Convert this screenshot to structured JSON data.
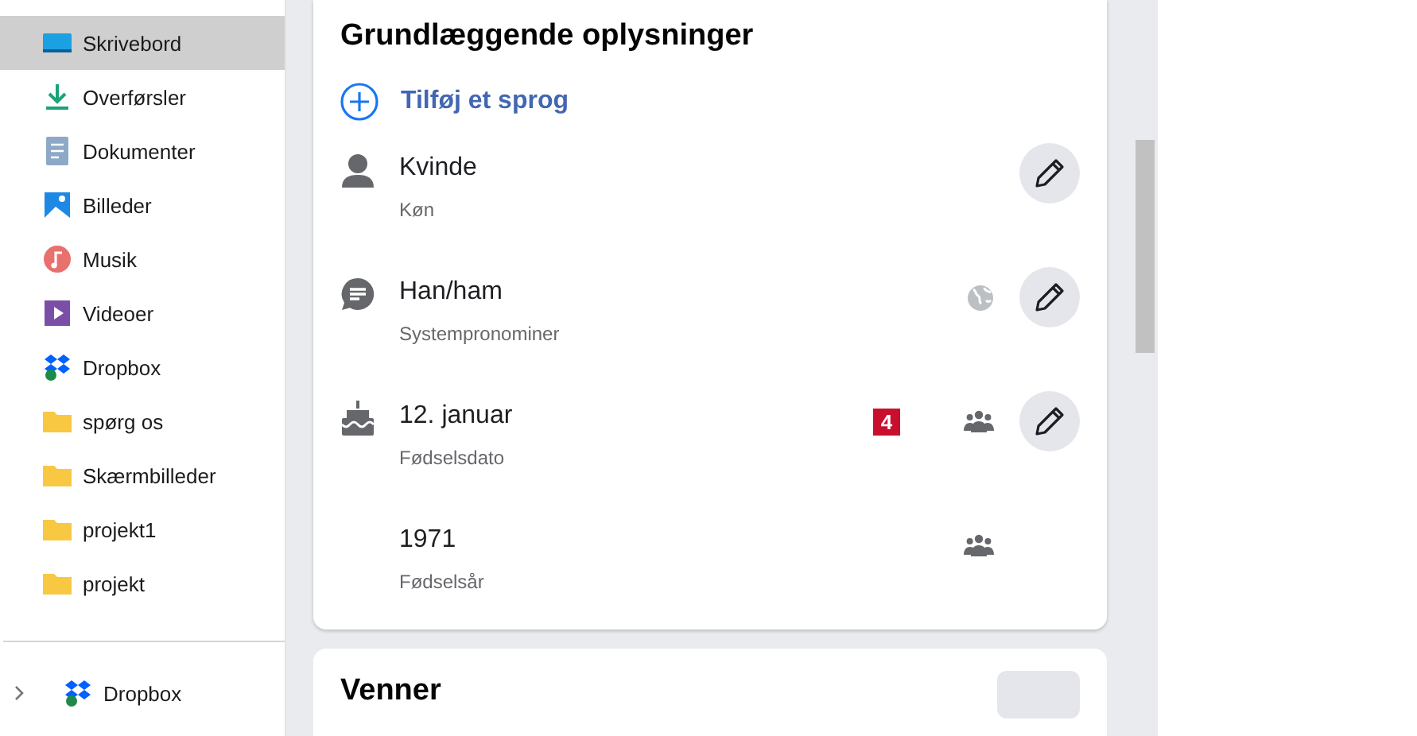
{
  "sidebar": {
    "items": [
      {
        "label": "Skrivebord",
        "kind": "desktop",
        "selected": true
      },
      {
        "label": "Overførsler",
        "kind": "download",
        "selected": false
      },
      {
        "label": "Dokumenter",
        "kind": "document",
        "selected": false
      },
      {
        "label": "Billeder",
        "kind": "pictures",
        "selected": false
      },
      {
        "label": "Musik",
        "kind": "music",
        "selected": false
      },
      {
        "label": "Videoer",
        "kind": "video",
        "selected": false
      },
      {
        "label": "Dropbox",
        "kind": "dropbox",
        "selected": false
      },
      {
        "label": "spørg os",
        "kind": "folder",
        "selected": false
      },
      {
        "label": "Skærmbilleder",
        "kind": "folder",
        "selected": false
      },
      {
        "label": "projekt1",
        "kind": "folder",
        "selected": false
      },
      {
        "label": "projekt",
        "kind": "folder",
        "selected": false
      }
    ],
    "footer": {
      "label": "Dropbox",
      "expanded": false
    }
  },
  "basic_info": {
    "title": "Grundlæggende oplysninger",
    "add_link": "Tilføj et sprog",
    "fields": [
      {
        "value": "Kvinde",
        "label": "Køn",
        "kind": "person",
        "editable": true
      },
      {
        "value": "Han/ham",
        "label": "Systempronominer",
        "kind": "chat",
        "audience": {
          "kind": "public"
        },
        "editable": true
      },
      {
        "value": "12. januar",
        "label": "Fødselsdato",
        "kind": "cake",
        "audience": {
          "kind": "friends"
        },
        "editable": true,
        "badge": "4"
      },
      {
        "value": "1971",
        "label": "Fødselsår",
        "kind": "plain",
        "audience": {
          "kind": "friends"
        },
        "editable": false
      }
    ]
  },
  "friends_card": {
    "title": "Venner"
  }
}
